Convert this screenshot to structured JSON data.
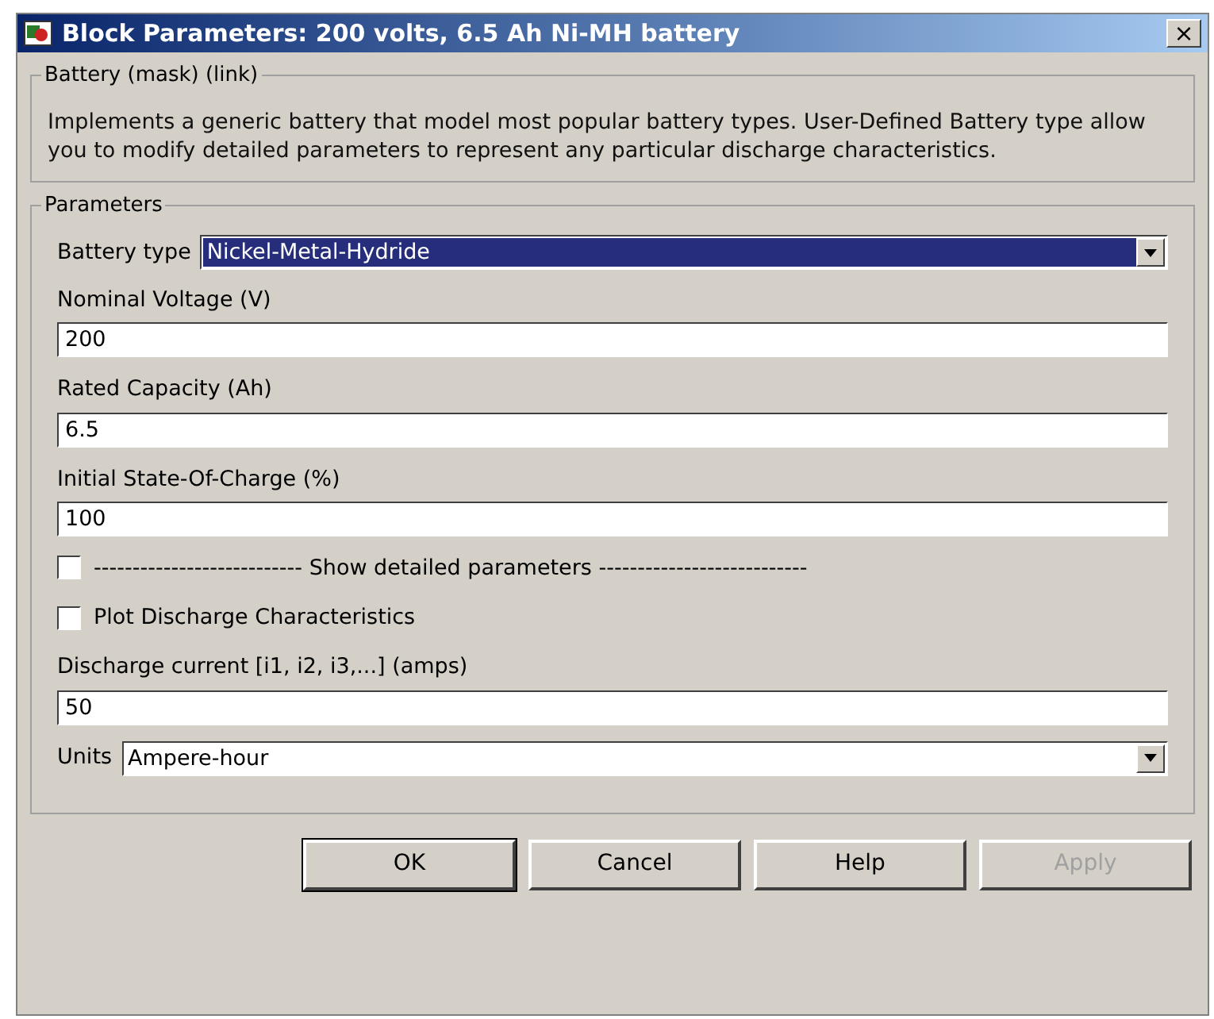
{
  "window": {
    "title": "Block Parameters: 200 volts, 6.5 Ah Ni-MH battery",
    "close": "×"
  },
  "description_group": {
    "title": "Battery (mask) (link)",
    "text": "Implements a generic battery that model most popular battery types. User-Defined Battery type allow you to modify detailed parameters  to represent any particular discharge characteristics."
  },
  "parameters_group": {
    "title": "Parameters",
    "items": [
      {
        "kind": "dropdown",
        "label": "Battery type",
        "value": "Nickel-Metal-Hydride",
        "highlighted": true
      },
      {
        "kind": "text",
        "label": "Nominal Voltage (V)",
        "value": "200"
      },
      {
        "kind": "text",
        "label": "Rated Capacity (Ah)",
        "value": "6.5"
      },
      {
        "kind": "text",
        "label": "Initial State-Of-Charge (%)",
        "value": "100"
      },
      {
        "kind": "checkbox",
        "label": "--------------------------- Show detailed parameters ---------------------------",
        "checked": false
      },
      {
        "kind": "checkbox",
        "label": "Plot Discharge Characteristics",
        "checked": false
      },
      {
        "kind": "text",
        "label": "Discharge current [i1, i2, i3,...] (amps)",
        "value": "50"
      },
      {
        "kind": "dropdown",
        "label": "Units",
        "value": "Ampere-hour",
        "highlighted": false
      }
    ]
  },
  "buttons": [
    {
      "label": "OK",
      "default": true,
      "disabled": false
    },
    {
      "label": "Cancel",
      "default": false,
      "disabled": false
    },
    {
      "label": "Help",
      "default": false,
      "disabled": false
    },
    {
      "label": "Apply",
      "default": false,
      "disabled": true
    }
  ]
}
